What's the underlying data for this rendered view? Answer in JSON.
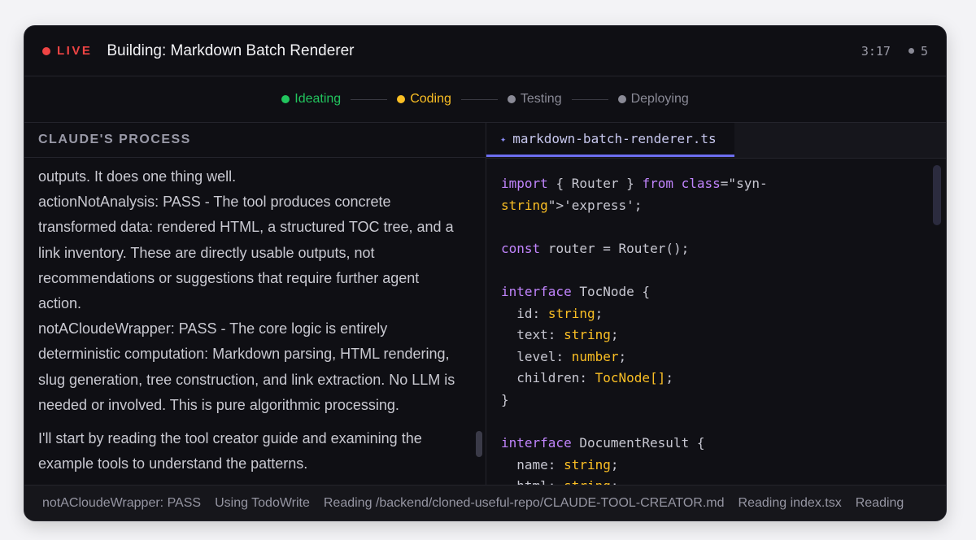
{
  "header": {
    "live_label": "LIVE",
    "title": "Building: Markdown Batch Renderer",
    "timer": "3:17",
    "count": "5"
  },
  "stages": [
    {
      "label": "Ideating",
      "status": "done",
      "color": "#22c55e"
    },
    {
      "label": "Coding",
      "status": "active",
      "color": "#fbbf24"
    },
    {
      "label": "Testing",
      "status": "pending",
      "color": "#8a8a96"
    },
    {
      "label": "Deploying",
      "status": "pending",
      "color": "#8a8a96"
    }
  ],
  "process": {
    "title": "CLAUDE'S PROCESS",
    "paragraphs": [
      "outputs. It does one thing well.",
      "actionNotAnalysis: PASS - The tool produces concrete transformed data: rendered HTML, a structured TOC tree, and a link inventory. These are directly usable outputs, not recommendations or suggestions that require further agent action.",
      "notACloudeWrapper: PASS - The core logic is entirely deterministic computation: Markdown parsing, HTML rendering, slug generation, tree construction, and link extraction. No LLM is needed or involved. This is pure algorithmic processing.",
      "I'll start by reading the tool creator guide and examining the example tools to understand the patterns."
    ]
  },
  "editor": {
    "tab_label": "markdown-batch-renderer.ts",
    "code_lines": [
      "import { Router } from class=\"syn-",
      "string\">'express';",
      "",
      "const router = Router();",
      "",
      "interface TocNode {",
      "  id: string;",
      "  text: string;",
      "  level: number;",
      "  children: TocNode[];",
      "}",
      "",
      "interface DocumentResult {",
      "  name: string;",
      "  html: string;"
    ]
  },
  "activity": [
    "notACloudeWrapper: PASS",
    "Using TodoWrite",
    "Reading /backend/cloned-useful-repo/CLAUDE-TOOL-CREATOR.md",
    "Reading index.tsx",
    "Reading"
  ]
}
